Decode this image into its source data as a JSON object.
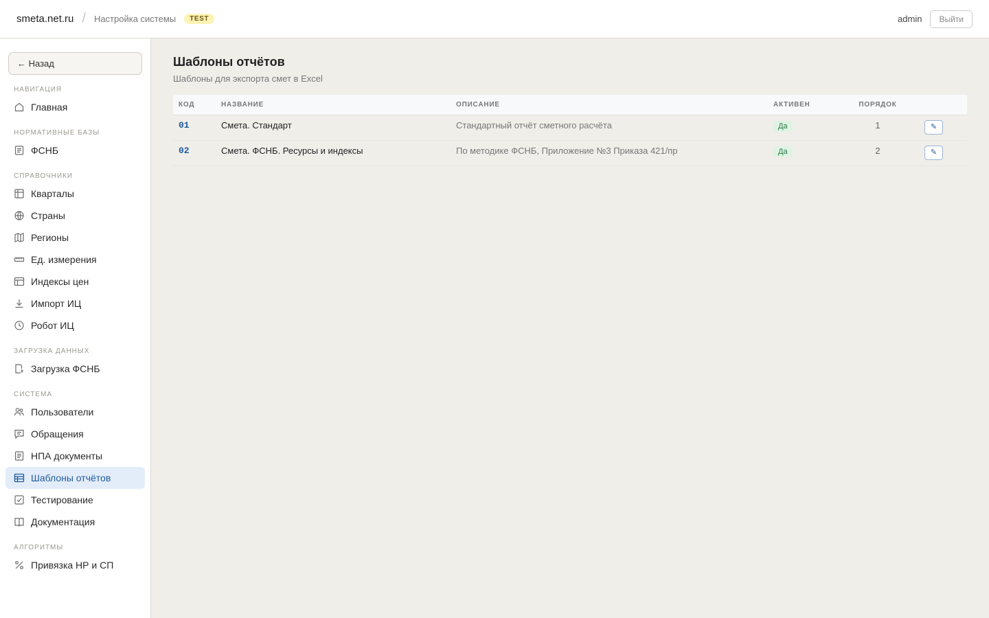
{
  "header": {
    "brand": "smeta.net.ru",
    "breadcrumb": "Настройка системы",
    "env_badge": "TEST",
    "user": "admin",
    "logout_label": "Выйти"
  },
  "sidebar": {
    "back_label": "← Назад",
    "sections": {
      "nav": "НАВИГАЦИЯ",
      "norm": "НОРМАТИВНЫЕ БАЗЫ",
      "refs": "СПРАВОЧНИКИ",
      "load": "ЗАГРУЗКА ДАННЫХ",
      "system": "СИСТЕМА",
      "algo": "АЛГОРИТМЫ"
    },
    "items": {
      "home": "Главная",
      "fsnb": "ФСНБ",
      "quarters": "Кварталы",
      "countries": "Страны",
      "regions": "Регионы",
      "units": "Ед. измерения",
      "price_index": "Индексы цен",
      "import_ic": "Импорт ИЦ",
      "robot_ic": "Робот ИЦ",
      "load_fsnb": "Загрузка ФСНБ",
      "users": "Пользователи",
      "requests": "Обращения",
      "npa": "НПА документы",
      "templates": "Шаблоны отчётов",
      "testing": "Тестирование",
      "docs": "Документация",
      "binding": "Привязка НР и СП"
    },
    "active_item": "templates"
  },
  "main": {
    "title": "Шаблоны отчётов",
    "subtitle": "Шаблоны для экспорта смет в Excel",
    "columns": {
      "code": "КОД",
      "name": "НАЗВАНИЕ",
      "description": "ОПИСАНИЕ",
      "active": "АКТИВЕН",
      "order": "ПОРЯДОК"
    },
    "rows": [
      {
        "code": "01",
        "name": "Смета. Стандарт",
        "description": "Стандартный отчёт сметного расчёта",
        "active": "Да",
        "order": "1",
        "edit_icon": "✎"
      },
      {
        "code": "02",
        "name": "Смета. ФСНБ. Ресурсы и индексы",
        "description": "По методике ФСНБ, Приложение №3 Приказа 421/пр",
        "active": "Да",
        "order": "2",
        "edit_icon": "✎"
      }
    ]
  },
  "colors": {
    "accent": "#1f5a9e",
    "active_bg": "#e3edf9",
    "badge_yes_bg": "#dff3e4",
    "test_badge_bg": "#fdf3b4"
  }
}
